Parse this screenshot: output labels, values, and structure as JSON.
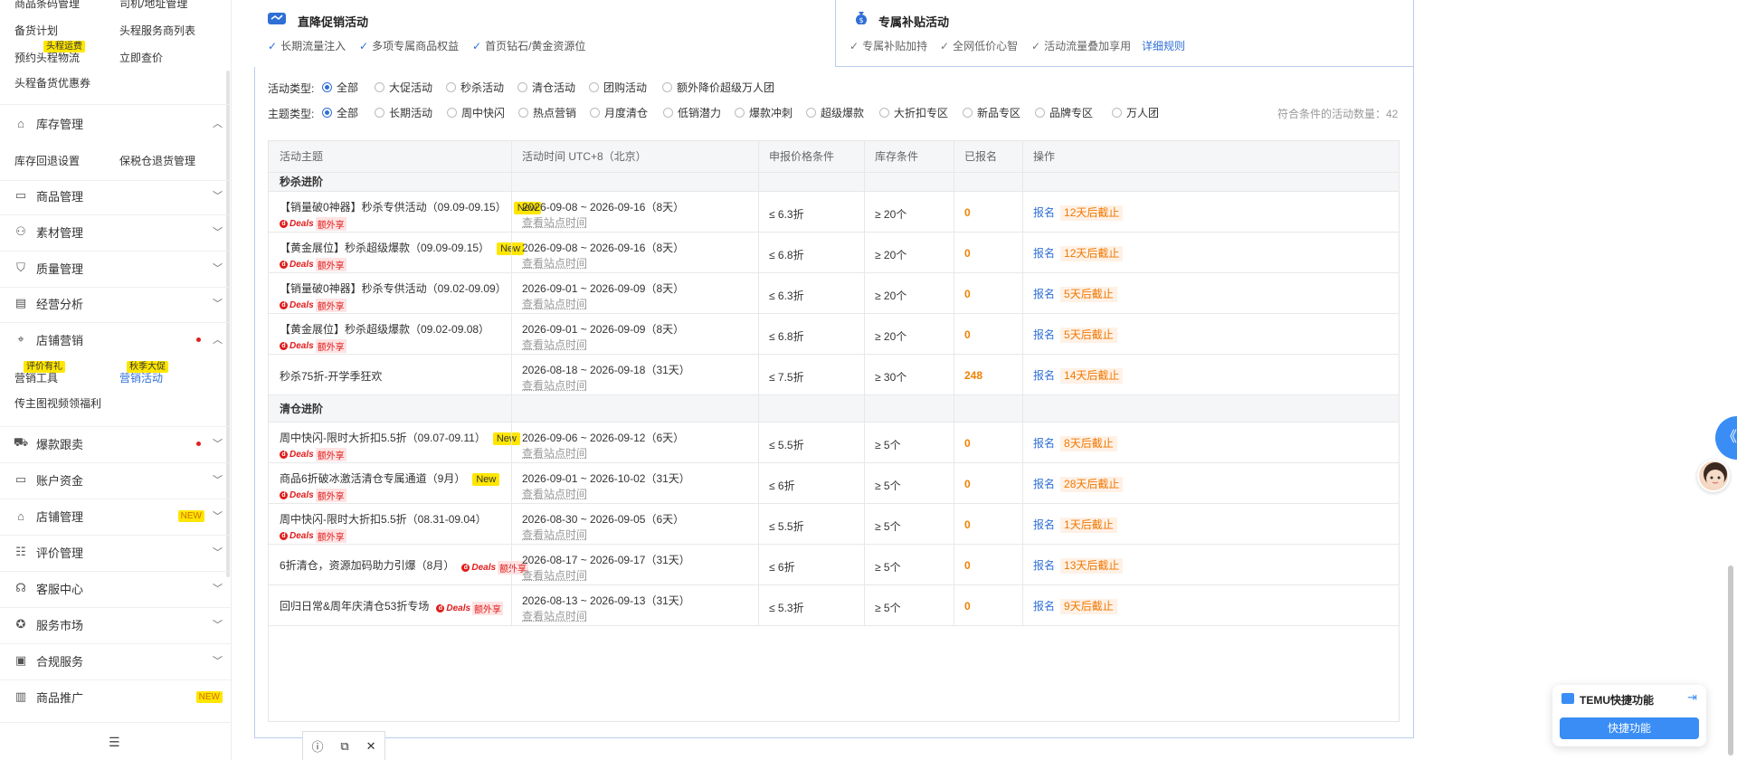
{
  "sidebar": {
    "top_items": [
      {
        "label": "商品条码管理"
      },
      {
        "label": "司机/地址管理"
      },
      {
        "label": "备货计划"
      },
      {
        "label": "头程服务商列表"
      },
      {
        "label": "预约头程物流",
        "tag": "头程运费"
      },
      {
        "label": "立即查价"
      },
      {
        "label": "头程备货优惠券"
      }
    ],
    "sections": [
      {
        "name": "inventory",
        "label": "库存管理",
        "icon": "warehouse-icon",
        "expanded": true
      },
      {
        "name": "products",
        "label": "商品管理",
        "icon": "box-icon"
      },
      {
        "name": "materials",
        "label": "素材管理",
        "icon": "materials-icon"
      },
      {
        "name": "quality",
        "label": "质量管理",
        "icon": "shield-icon"
      },
      {
        "name": "analytics",
        "label": "经营分析",
        "icon": "chart-icon"
      },
      {
        "name": "marketing",
        "label": "店铺营销",
        "icon": "tag-icon",
        "expanded": true,
        "dot": true
      },
      {
        "name": "hot-sale",
        "label": "爆款跟卖",
        "icon": "cart-icon",
        "dot": true
      },
      {
        "name": "funds",
        "label": "账户资金",
        "icon": "wallet-icon"
      },
      {
        "name": "shop",
        "label": "店铺管理",
        "icon": "shop-icon",
        "badge": "NEW"
      },
      {
        "name": "reviews",
        "label": "评价管理",
        "icon": "review-icon"
      },
      {
        "name": "service-center",
        "label": "客服中心",
        "icon": "headset-icon"
      },
      {
        "name": "market",
        "label": "服务市场",
        "icon": "star-icon"
      },
      {
        "name": "compliance",
        "label": "合规服务",
        "icon": "compliance-icon"
      },
      {
        "name": "promotion",
        "label": "商品推广",
        "icon": "promote-icon",
        "badge": "NEW"
      }
    ],
    "inventory_sub": [
      "库存回退设置",
      "保税仓退货管理"
    ],
    "marketing_sub": [
      {
        "label": "营销工具",
        "tag": "评价有礼"
      },
      {
        "label": "营销活动",
        "tag": "秋季大促",
        "active": true
      },
      {
        "label": "传主图视频领福利"
      }
    ],
    "collapse_icon": "collapse-menu-icon"
  },
  "cards": {
    "left": {
      "title": "直降促销活动",
      "features": [
        "长期流量注入",
        "多项专属商品权益",
        "首页钻石/黄金资源位"
      ],
      "accent": "#2f6fd6"
    },
    "right": {
      "title": "专属补贴活动",
      "features": [
        "专属补贴加持",
        "全网低价心智",
        "活动流量叠加享用"
      ],
      "link": "详细规则",
      "accent": "#666666"
    }
  },
  "filters": {
    "activity_type": {
      "label": "活动类型:",
      "options": [
        "全部",
        "大促活动",
        "秒杀活动",
        "清仓活动",
        "团购活动",
        "额外降价超级万人团"
      ],
      "selected": 0
    },
    "theme_type": {
      "label": "主题类型:",
      "options": [
        "全部",
        "长期活动",
        "周中快闪",
        "热点营销",
        "月度清仓",
        "低销潜力",
        "爆款冲刺",
        "超级爆款",
        "大折扣专区",
        "新品专区",
        "品牌专区",
        "万人团"
      ],
      "selected": 0
    },
    "count_text": "符合条件的活动数量：42"
  },
  "table": {
    "headers": [
      "活动主题",
      "活动时间 UTC+8（北京）",
      "申报价格条件",
      "库存条件",
      "已报名",
      "操作"
    ],
    "sub_link": "查看站点时间",
    "action_label": "报名",
    "deals_label": "Deals",
    "deals_extra": "额外享",
    "new_label": "New",
    "groups": [
      {
        "title": "秒杀进阶",
        "rows": [
          {
            "theme": "【销量破0神器】秒杀专供活动（09.09-09.15）",
            "new": true,
            "deals": true,
            "time": "2026-09-08 ~ 2026-09-16（8天）",
            "price": "≤ 6.3折",
            "stock": "≥ 20个",
            "enrolled": "0",
            "deadline": "12天后截止"
          },
          {
            "theme": "【黄金展位】秒杀超级爆款（09.09-09.15）",
            "new": true,
            "deals": true,
            "time": "2026-09-08 ~ 2026-09-16（8天）",
            "price": "≤ 6.8折",
            "stock": "≥ 20个",
            "enrolled": "0",
            "deadline": "12天后截止"
          },
          {
            "theme": "【销量破0神器】秒杀专供活动（09.02-09.09）",
            "new": false,
            "deals": true,
            "time": "2026-09-01 ~ 2026-09-09（8天）",
            "price": "≤ 6.3折",
            "stock": "≥ 20个",
            "enrolled": "0",
            "deadline": "5天后截止"
          },
          {
            "theme": "【黄金展位】秒杀超级爆款（09.02-09.08）",
            "new": false,
            "deals": true,
            "time": "2026-09-01 ~ 2026-09-09（8天）",
            "price": "≤ 6.8折",
            "stock": "≥ 20个",
            "enrolled": "0",
            "deadline": "5天后截止"
          },
          {
            "theme": "秒杀75折-开学季狂欢",
            "new": false,
            "deals": false,
            "time": "2026-08-18 ~ 2026-09-18（31天）",
            "price": "≤ 7.5折",
            "stock": "≥ 30个",
            "enrolled": "248",
            "deadline": "14天后截止"
          }
        ]
      },
      {
        "title": "清仓进阶",
        "rows": [
          {
            "theme": "周中快闪-限时大折扣5.5折（09.07-09.11）",
            "new": true,
            "deals": true,
            "time": "2026-09-06 ~ 2026-09-12（6天）",
            "price": "≤ 5.5折",
            "stock": "≥ 5个",
            "enrolled": "0",
            "deadline": "8天后截止"
          },
          {
            "theme": "商品6折破冰激活清仓专属通道（9月）",
            "new": true,
            "deals": true,
            "time": "2026-09-01 ~ 2026-10-02（31天）",
            "price": "≤ 6折",
            "stock": "≥ 5个",
            "enrolled": "0",
            "deadline": "28天后截止"
          },
          {
            "theme": "周中快闪-限时大折扣5.5折（08.31-09.04）",
            "new": false,
            "deals": true,
            "time": "2026-08-30 ~ 2026-09-05（6天）",
            "price": "≤ 5.5折",
            "stock": "≥ 5个",
            "enrolled": "0",
            "deadline": "1天后截止"
          },
          {
            "theme": "6折清仓，资源加码助力引爆（8月）",
            "new": false,
            "deals": true,
            "inline_deals": true,
            "time": "2026-08-17 ~ 2026-09-17（31天）",
            "price": "≤ 6折",
            "stock": "≥ 5个",
            "enrolled": "0",
            "deadline": "13天后截止"
          },
          {
            "theme": "回归日常&周年庆清仓53折专场",
            "new": false,
            "deals": true,
            "inline_deals": true,
            "time": "2026-08-13 ~ 2026-09-13（31天）",
            "price": "≤ 5.3折",
            "stock": "≥ 5个",
            "enrolled": "0",
            "deadline": "9天后截止"
          }
        ]
      }
    ]
  },
  "float": {
    "temu_title": "TEMU快捷功能",
    "temu_button": "快捷功能",
    "expand_icon": "double-chevron-left-icon"
  },
  "bottom_tools": [
    "help-icon",
    "expand-icon",
    "close-icon"
  ],
  "colors": {
    "accent": "#2f6fd6",
    "orange": "#f08000",
    "new_badge": "#ffe600",
    "deals_red": "#e01a1a"
  }
}
